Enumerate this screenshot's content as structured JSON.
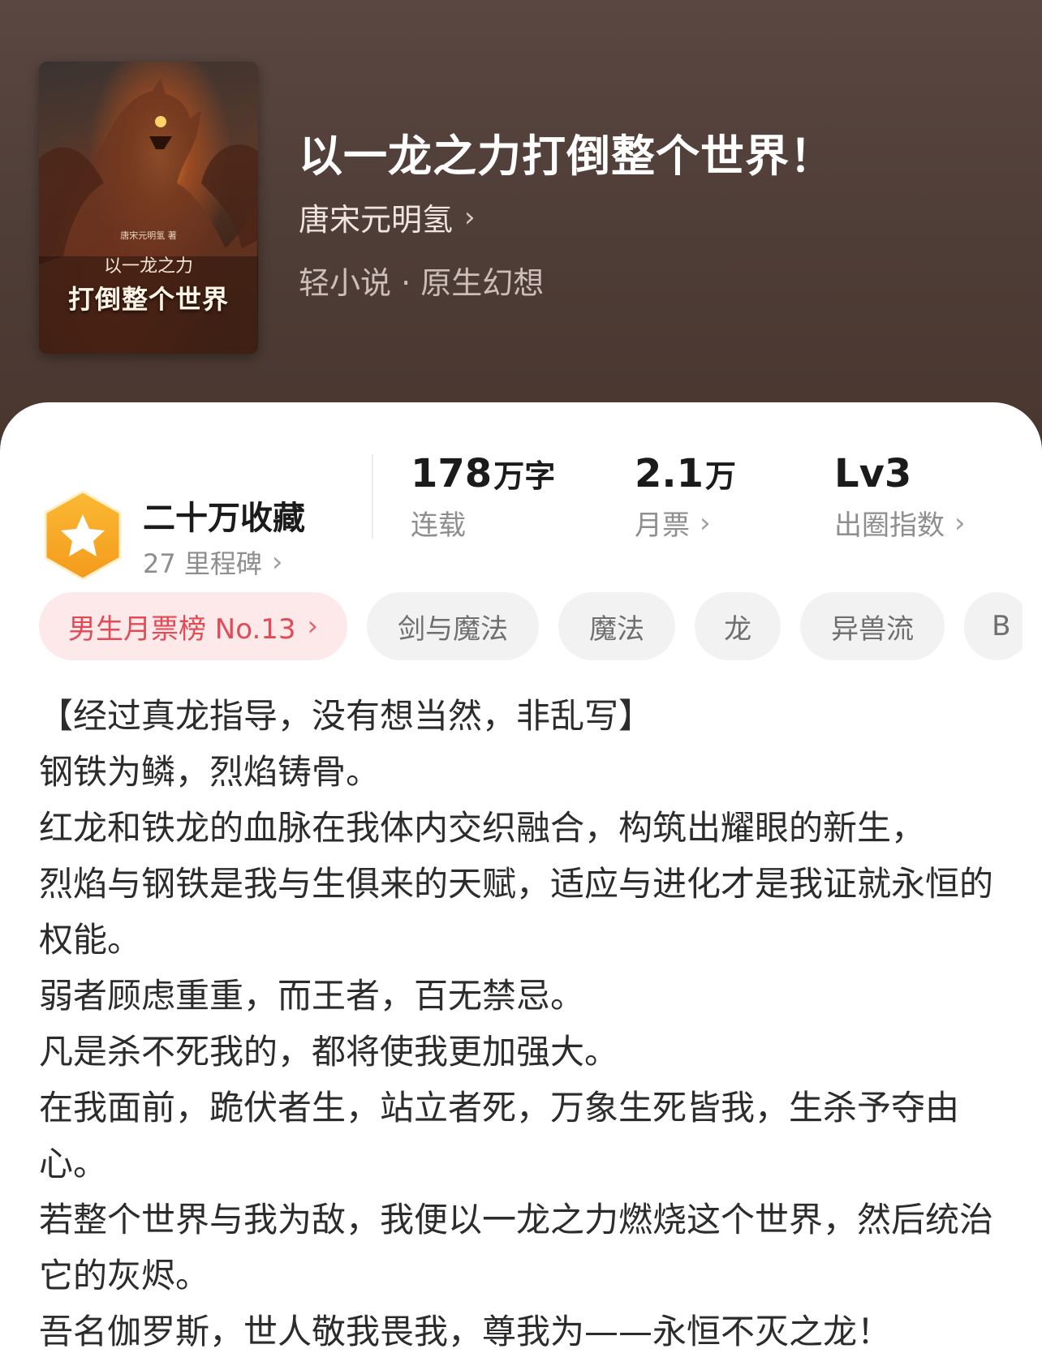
{
  "book": {
    "cover": {
      "author": "唐宋元明氢 著",
      "subtitle": "以一龙之力",
      "title": "打倒整个世界"
    },
    "title": "以一龙之力打倒整个世界！",
    "author": "唐宋元明氢",
    "genre": "轻小说 · 原生幻想"
  },
  "collection": {
    "title": "二十万收藏",
    "milestone": "27 里程碑"
  },
  "stats": [
    {
      "value": "178",
      "unit": "万字",
      "label": "连载"
    },
    {
      "value": "2.1",
      "unit": "万",
      "label": "月票"
    },
    {
      "value": "Lv3",
      "unit": "",
      "label": "出圈指数"
    }
  ],
  "tags": [
    "男生月票榜 No.13",
    "剑与魔法",
    "魔法",
    "龙",
    "异兽流",
    "B"
  ],
  "description": [
    "【经过真龙指导，没有想当然，非乱写】",
    "钢铁为鳞，烈焰铸骨。",
    "红龙和铁龙的血脉在我体内交织融合，构筑出耀眼的新生，",
    "烈焰与钢铁是我与生俱来的天赋，适应与进化才是我证就永恒的权能。",
    "弱者顾虑重重，而王者，百无禁忌。",
    "凡是杀不死我的，都将使我更加强大。",
    "在我面前，跪伏者生，站立者死，万象生死皆我，生杀予夺由心。",
    "若整个世界与我为敌，我便以一龙之力燃烧这个世界，然后统治它的灰烬。",
    "吾名伽罗斯，世人敬我畏我，尊我为——永恒不灭之龙！"
  ],
  "colors": {
    "header_bg": "#4e3c36",
    "badge": "#f6a623",
    "rank_tag_bg": "#fde9ea",
    "rank_tag_text": "#e24a56"
  }
}
